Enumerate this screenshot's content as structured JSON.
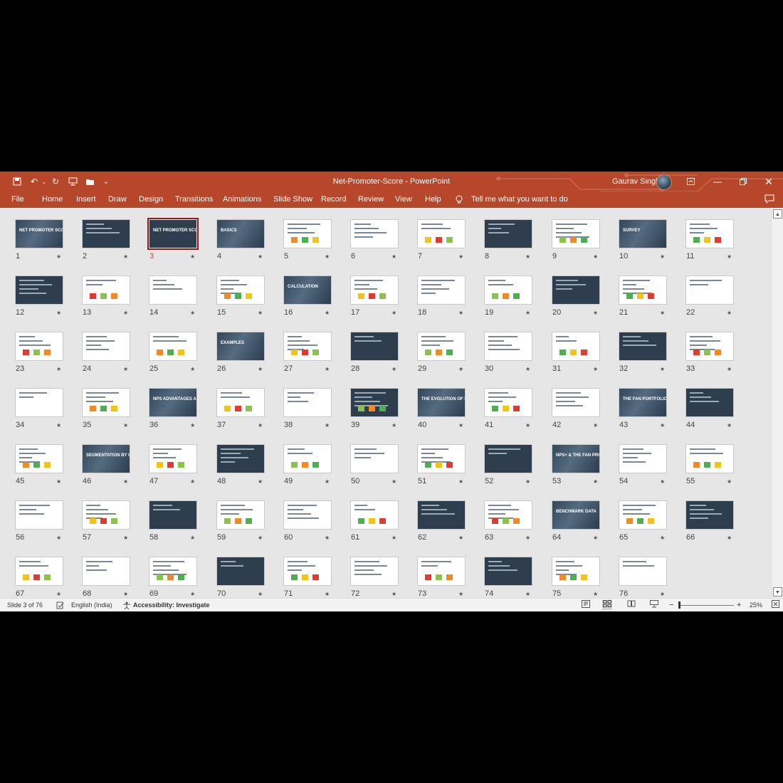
{
  "titlebar": {
    "document_title": "Net-Promoter-Score  -  PowerPoint",
    "user_name": "Gaurav Singh",
    "quick_access_icons": [
      "save-icon",
      "undo-icon",
      "redo-icon",
      "present-from-beginning-icon",
      "open-icon",
      "customize-icon"
    ],
    "window_controls": [
      "ribbon-display-options-icon",
      "minimize-icon",
      "restore-icon",
      "close-icon"
    ]
  },
  "ribbon": {
    "tabs": [
      "File",
      "Home",
      "Insert",
      "Draw",
      "Design",
      "Transitions",
      "Animations",
      "Slide Show",
      "Record",
      "Review",
      "View",
      "Help"
    ],
    "tell_me": "Tell me what you want to do"
  },
  "colors": {
    "accent": "#b7472a",
    "selection": "#8b1c1c",
    "dark_slide": "#2f3e4e"
  },
  "slides": [
    {
      "num": "1",
      "style": "photo",
      "title": "NET PROMOTER SCORE (NPS) & NPS+"
    },
    {
      "num": "2",
      "style": "dark",
      "title": ""
    },
    {
      "num": "3",
      "style": "dark",
      "title": "NET PROMOTER SCORE",
      "selected": true
    },
    {
      "num": "4",
      "style": "photo",
      "title": "BASICS"
    },
    {
      "num": "5",
      "style": "light",
      "title": ""
    },
    {
      "num": "6",
      "style": "light",
      "title": ""
    },
    {
      "num": "7",
      "style": "light",
      "title": ""
    },
    {
      "num": "8",
      "style": "dark",
      "title": ""
    },
    {
      "num": "9",
      "style": "light",
      "title": ""
    },
    {
      "num": "10",
      "style": "photo",
      "title": "SURVEY"
    },
    {
      "num": "11",
      "style": "light",
      "title": ""
    },
    {
      "num": "12",
      "style": "dark",
      "title": ""
    },
    {
      "num": "13",
      "style": "light",
      "title": ""
    },
    {
      "num": "14",
      "style": "light",
      "title": ""
    },
    {
      "num": "15",
      "style": "light",
      "title": ""
    },
    {
      "num": "16",
      "style": "photo",
      "title": "CALCULATION"
    },
    {
      "num": "17",
      "style": "light",
      "title": ""
    },
    {
      "num": "18",
      "style": "light",
      "title": ""
    },
    {
      "num": "19",
      "style": "light",
      "title": ""
    },
    {
      "num": "20",
      "style": "dark",
      "title": ""
    },
    {
      "num": "21",
      "style": "light",
      "title": ""
    },
    {
      "num": "22",
      "style": "light",
      "title": ""
    },
    {
      "num": "23",
      "style": "light",
      "title": ""
    },
    {
      "num": "24",
      "style": "light",
      "title": ""
    },
    {
      "num": "25",
      "style": "light",
      "title": ""
    },
    {
      "num": "26",
      "style": "photo",
      "title": "EXAMPLES"
    },
    {
      "num": "27",
      "style": "light",
      "title": ""
    },
    {
      "num": "28",
      "style": "dark",
      "title": ""
    },
    {
      "num": "29",
      "style": "light",
      "title": ""
    },
    {
      "num": "30",
      "style": "light",
      "title": ""
    },
    {
      "num": "31",
      "style": "light",
      "title": ""
    },
    {
      "num": "32",
      "style": "dark",
      "title": ""
    },
    {
      "num": "33",
      "style": "light",
      "title": ""
    },
    {
      "num": "34",
      "style": "light",
      "title": ""
    },
    {
      "num": "35",
      "style": "light",
      "title": ""
    },
    {
      "num": "36",
      "style": "photo",
      "title": "NPS ADVANTAGES AND LIMITS"
    },
    {
      "num": "37",
      "style": "light",
      "title": ""
    },
    {
      "num": "38",
      "style": "light",
      "title": ""
    },
    {
      "num": "39",
      "style": "dark",
      "title": ""
    },
    {
      "num": "40",
      "style": "photo",
      "title": "THE EVOLUTION OF NPS"
    },
    {
      "num": "41",
      "style": "light",
      "title": ""
    },
    {
      "num": "42",
      "style": "light",
      "title": ""
    },
    {
      "num": "43",
      "style": "photo",
      "title": "THE FAN PORTFOLIO"
    },
    {
      "num": "44",
      "style": "dark",
      "title": ""
    },
    {
      "num": "45",
      "style": "light",
      "title": ""
    },
    {
      "num": "46",
      "style": "photo",
      "title": "SEGMENTATION BY CUSTOMER VALUE"
    },
    {
      "num": "47",
      "style": "light",
      "title": ""
    },
    {
      "num": "48",
      "style": "dark",
      "title": ""
    },
    {
      "num": "49",
      "style": "light",
      "title": ""
    },
    {
      "num": "50",
      "style": "light",
      "title": ""
    },
    {
      "num": "51",
      "style": "light",
      "title": ""
    },
    {
      "num": "52",
      "style": "dark",
      "title": ""
    },
    {
      "num": "53",
      "style": "photo",
      "title": "NPS+ & THE FAN PRINCIPLE"
    },
    {
      "num": "54",
      "style": "light",
      "title": ""
    },
    {
      "num": "55",
      "style": "light",
      "title": ""
    },
    {
      "num": "56",
      "style": "light",
      "title": ""
    },
    {
      "num": "57",
      "style": "light",
      "title": ""
    },
    {
      "num": "58",
      "style": "dark",
      "title": ""
    },
    {
      "num": "59",
      "style": "light",
      "title": ""
    },
    {
      "num": "60",
      "style": "light",
      "title": ""
    },
    {
      "num": "61",
      "style": "light",
      "title": ""
    },
    {
      "num": "62",
      "style": "dark",
      "title": ""
    },
    {
      "num": "63",
      "style": "light",
      "title": ""
    },
    {
      "num": "64",
      "style": "photo",
      "title": "BENCHMARK DATA"
    },
    {
      "num": "65",
      "style": "light",
      "title": ""
    },
    {
      "num": "66",
      "style": "dark",
      "title": ""
    },
    {
      "num": "67",
      "style": "light",
      "title": ""
    },
    {
      "num": "68",
      "style": "light",
      "title": ""
    },
    {
      "num": "69",
      "style": "light",
      "title": ""
    },
    {
      "num": "70",
      "style": "dark",
      "title": ""
    },
    {
      "num": "71",
      "style": "light",
      "title": ""
    },
    {
      "num": "72",
      "style": "light",
      "title": ""
    },
    {
      "num": "73",
      "style": "light",
      "title": ""
    },
    {
      "num": "74",
      "style": "dark",
      "title": ""
    },
    {
      "num": "75",
      "style": "light",
      "title": ""
    },
    {
      "num": "76",
      "style": "light",
      "title": ""
    }
  ],
  "statusbar": {
    "slide_info": "Slide 3 of 76",
    "language": "English (India)",
    "accessibility": "Accessibility: Investigate",
    "zoom_out": "−",
    "zoom_in": "+",
    "zoom_level": "25%"
  }
}
